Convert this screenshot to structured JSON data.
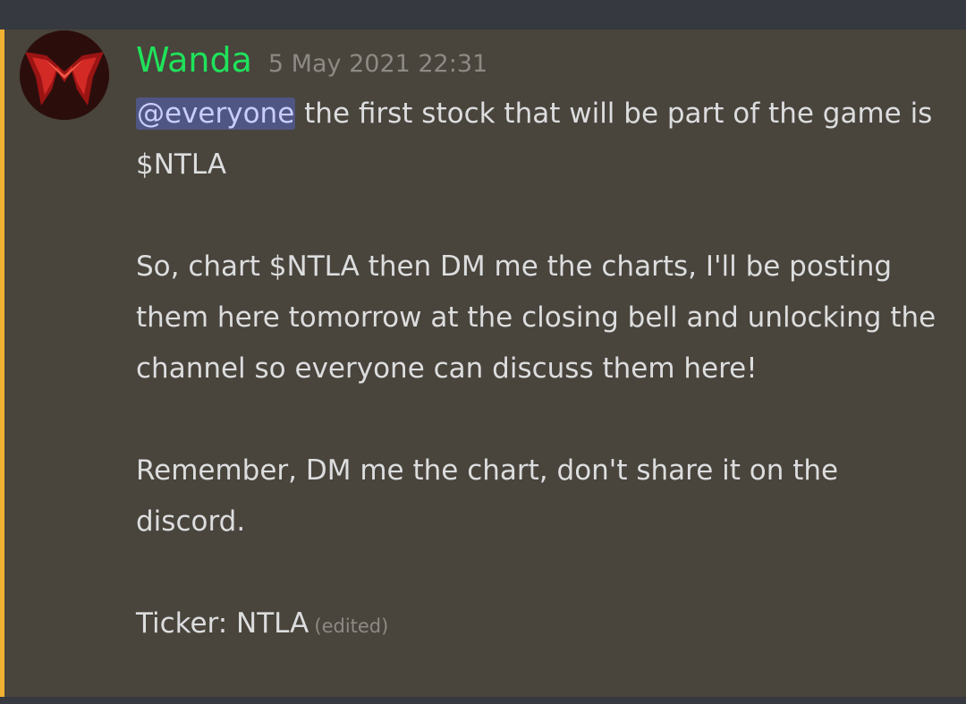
{
  "colors": {
    "background": "#36393f",
    "message_highlight": "#49443c",
    "mention_bar": "#f0b132",
    "username": "#1fe35a",
    "timestamp": "#8d8a85",
    "text": "#dcddde",
    "mention_bg": "#505684",
    "mention_text": "#c9cdfb"
  },
  "message": {
    "avatar_icon": "scarlet-witch-crown-icon",
    "username": "Wanda",
    "timestamp": "5 May 2021 22:31",
    "mention": "@everyone",
    "line1_rest": " the first stock that will be part of the game is $NTLA",
    "paragraph2": "So, chart $NTLA then DM me the charts, I'll be posting them here tomorrow at the closing bell and unlocking the channel so everyone can discuss them here!",
    "paragraph3": "Remember, DM me the chart, don't share it on the discord.",
    "paragraph4": "Ticker: NTLA",
    "edited_label": "(edited)"
  }
}
